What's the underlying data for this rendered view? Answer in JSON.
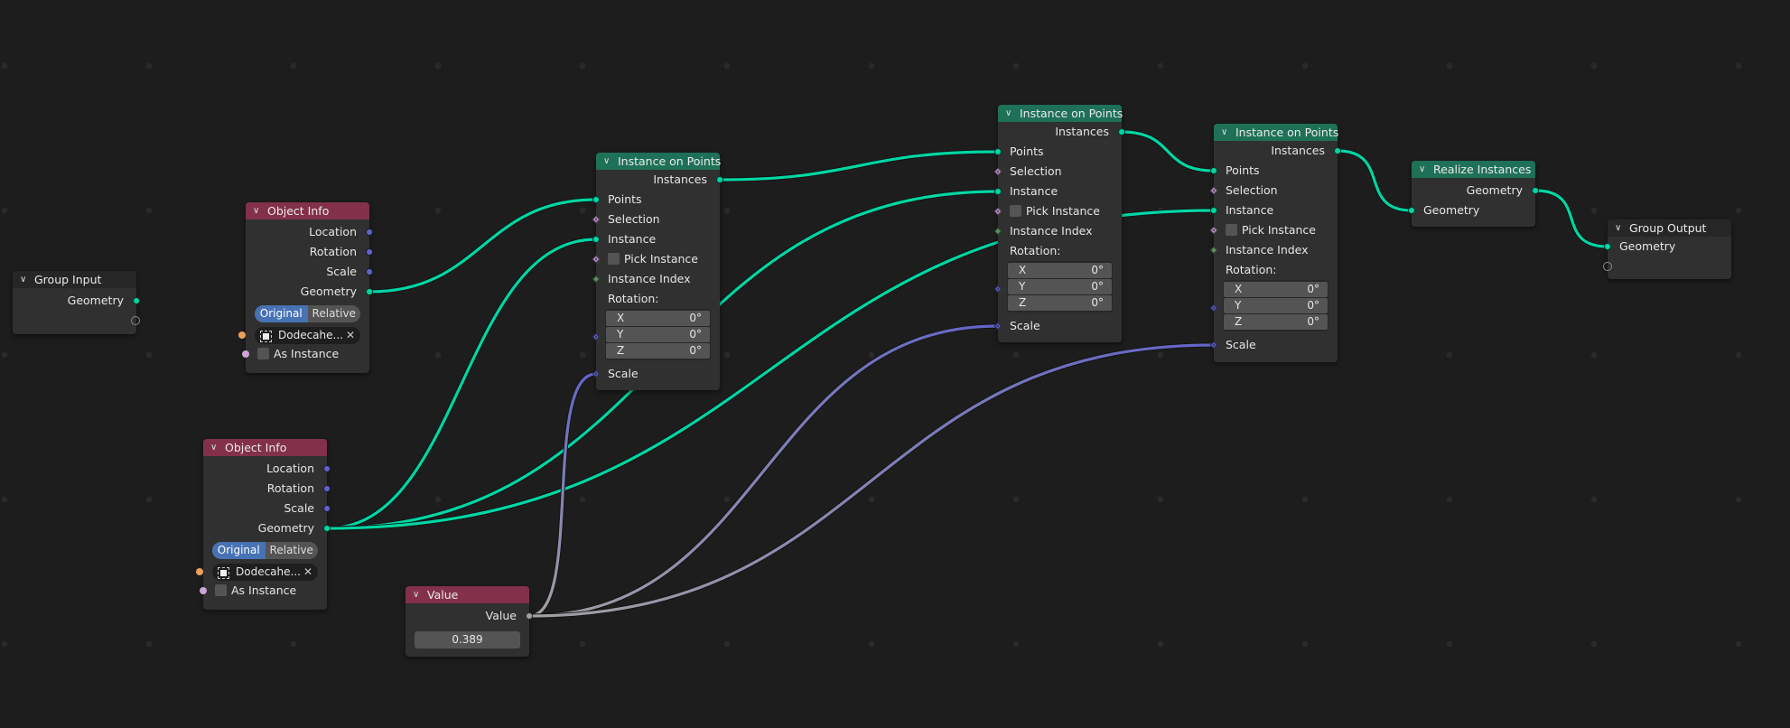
{
  "colors": {
    "background": "#1d1d1d",
    "node_body": "#303030",
    "header_input": "#83314a",
    "header_geometry": "#1e7157",
    "geometry_socket": "#00d6a3",
    "vector_socket": "#6363c7",
    "float_socket": "#a1a1a1",
    "boolean_socket": "#cca6d6",
    "object_socket": "#ed9e5c",
    "integer_socket": "#5f8f5f",
    "active_toggle": "#4772b3"
  },
  "nodes": {
    "group_input": {
      "title": "Group Input",
      "outputs": [
        "Geometry"
      ]
    },
    "object_info_1": {
      "title": "Object Info",
      "outputs": [
        "Location",
        "Rotation",
        "Scale",
        "Geometry"
      ],
      "transform_space": {
        "options": [
          "Original",
          "Relative"
        ],
        "selected": "Original"
      },
      "object": "Dodecahe...",
      "as_instance_label": "As Instance",
      "as_instance": false
    },
    "object_info_2": {
      "title": "Object Info",
      "outputs": [
        "Location",
        "Rotation",
        "Scale",
        "Geometry"
      ],
      "transform_space": {
        "options": [
          "Original",
          "Relative"
        ],
        "selected": "Original"
      },
      "object": "Dodecahe...",
      "as_instance_label": "As Instance",
      "as_instance": false
    },
    "value": {
      "title": "Value",
      "output": "Value",
      "value": "0.389"
    },
    "instance_on_points_1": {
      "title": "Instance on Points",
      "output": "Instances",
      "inputs": [
        "Points",
        "Selection",
        "Instance",
        "Pick Instance",
        "Instance Index"
      ],
      "rotation_label": "Rotation:",
      "rotation": [
        {
          "axis": "X",
          "value": "0°"
        },
        {
          "axis": "Y",
          "value": "0°"
        },
        {
          "axis": "Z",
          "value": "0°"
        }
      ],
      "scale_label": "Scale"
    },
    "instance_on_points_2": {
      "title": "Instance on Points",
      "output": "Instances",
      "inputs": [
        "Points",
        "Selection",
        "Instance",
        "Pick Instance",
        "Instance Index"
      ],
      "rotation_label": "Rotation:",
      "rotation": [
        {
          "axis": "X",
          "value": "0°"
        },
        {
          "axis": "Y",
          "value": "0°"
        },
        {
          "axis": "Z",
          "value": "0°"
        }
      ],
      "scale_label": "Scale"
    },
    "instance_on_points_3": {
      "title": "Instance on Points",
      "output": "Instances",
      "inputs": [
        "Points",
        "Selection",
        "Instance",
        "Pick Instance",
        "Instance Index"
      ],
      "rotation_label": "Rotation:",
      "rotation": [
        {
          "axis": "X",
          "value": "0°"
        },
        {
          "axis": "Y",
          "value": "0°"
        },
        {
          "axis": "Z",
          "value": "0°"
        }
      ],
      "scale_label": "Scale"
    },
    "realize_instances": {
      "title": "Realize Instances",
      "output": "Geometry",
      "input": "Geometry"
    },
    "group_output": {
      "title": "Group Output",
      "inputs": [
        "Geometry"
      ]
    }
  },
  "links": [
    {
      "from": "oi1-geometry",
      "to": "iop1-points",
      "type": "geo"
    },
    {
      "from": "oi2-geometry",
      "to": "iop1-instance",
      "type": "geo"
    },
    {
      "from": "oi2-geometry",
      "to": "iop2-instance",
      "type": "geo"
    },
    {
      "from": "oi2-geometry",
      "to": "iop3-instance",
      "type": "geo"
    },
    {
      "from": "iop1-instances",
      "to": "iop2-points",
      "type": "geo"
    },
    {
      "from": "iop2-instances",
      "to": "iop3-points",
      "type": "geo"
    },
    {
      "from": "iop3-instances",
      "to": "ri-geometry-in",
      "type": "geo"
    },
    {
      "from": "ri-geometry-out",
      "to": "go-geometry",
      "type": "geo"
    },
    {
      "from": "value-out",
      "to": "iop1-scale",
      "type": "float-vec"
    },
    {
      "from": "value-out",
      "to": "iop2-scale",
      "type": "float-vec"
    },
    {
      "from": "value-out",
      "to": "iop3-scale",
      "type": "float-vec"
    }
  ]
}
